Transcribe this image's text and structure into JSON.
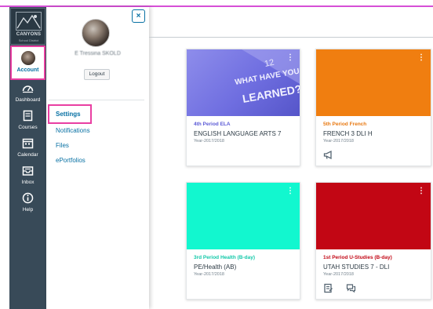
{
  "branding": {
    "logo_text": "CANYONS",
    "logo_subtext": "School District"
  },
  "global_nav": {
    "account_label": "Account",
    "items": [
      {
        "label": "Dashboard",
        "icon": "dashboard-icon"
      },
      {
        "label": "Courses",
        "icon": "courses-icon"
      },
      {
        "label": "Calendar",
        "icon": "calendar-icon"
      },
      {
        "label": "Inbox",
        "icon": "inbox-icon"
      },
      {
        "label": "Help",
        "icon": "help-icon"
      }
    ]
  },
  "account_tray": {
    "close_label": "×",
    "user_name": "E Tressina SKOLD",
    "logout_label": "Logout",
    "links": [
      "Settings",
      "Notifications",
      "Files",
      "ePortfolios"
    ]
  },
  "courses": [
    {
      "nickname": "",
      "name": "",
      "term": "",
      "color": "#ee0612"
    },
    {
      "nickname": "4th Period ELA",
      "name": "ENGLISH LANGUAGE ARTS 7",
      "term": "Year-2017/2018",
      "color": "#7a79e3",
      "nick_color": "#5b5ad6",
      "hero_text": "WHAT HAVE YOU LEARNED?"
    },
    {
      "nickname": "5th Period French",
      "name": "FRENCH 3 DLI H",
      "term": "Year-2017/2018",
      "color": "#f07e10",
      "nick_color": "#e87810"
    },
    {
      "nickname": "",
      "name": "",
      "term": "",
      "color": "#2fbf2a"
    },
    {
      "nickname": "3rd Period Health (B-day)",
      "name": "PE/Health (AB)",
      "term": "Year-2017/2018",
      "color": "#12f7cf",
      "nick_color": "#12c9a9"
    },
    {
      "nickname": "1st Period U-Studies (B-day)",
      "name": "UTAH STUDIES 7 - DLI",
      "term": "Year-2017/2018",
      "color": "#c20614",
      "nick_color": "#c20614"
    }
  ],
  "colors": {
    "nav_bg": "#384a58",
    "highlight": "#e93fa2",
    "link": "#0770a3"
  }
}
